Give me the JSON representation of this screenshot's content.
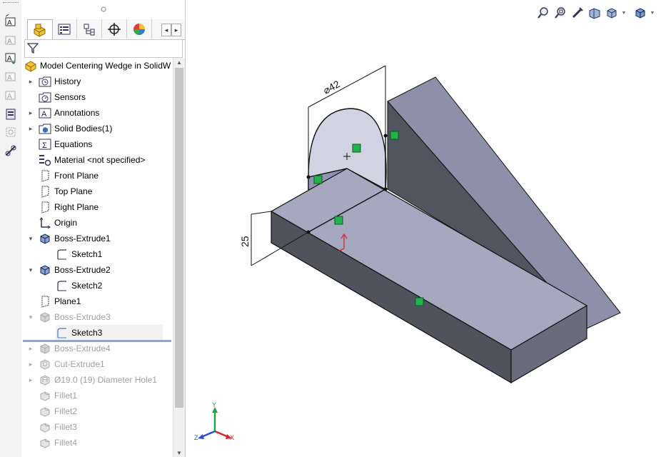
{
  "feature_tree": {
    "root": "Model Centering Wedge in SolidW",
    "items": [
      {
        "label": "History",
        "expander": "▸",
        "icon": "history-icon",
        "state": "normal"
      },
      {
        "label": "Sensors",
        "expander": "",
        "icon": "sensors-icon",
        "state": "normal"
      },
      {
        "label": "Annotations",
        "expander": "▸",
        "icon": "annotations-icon",
        "state": "normal"
      },
      {
        "label": "Solid Bodies(1)",
        "expander": "▸",
        "icon": "solid-bodies-icon",
        "state": "normal"
      },
      {
        "label": "Equations",
        "expander": "",
        "icon": "equations-icon",
        "state": "normal"
      },
      {
        "label": "Material <not specified>",
        "expander": "",
        "icon": "material-icon",
        "state": "normal"
      },
      {
        "label": "Front Plane",
        "expander": "",
        "icon": "plane-icon",
        "state": "normal"
      },
      {
        "label": "Top Plane",
        "expander": "",
        "icon": "plane-icon",
        "state": "normal"
      },
      {
        "label": "Right Plane",
        "expander": "",
        "icon": "plane-icon",
        "state": "normal"
      },
      {
        "label": "Origin",
        "expander": "",
        "icon": "origin-icon",
        "state": "normal"
      },
      {
        "label": "Boss-Extrude1",
        "expander": "▾",
        "icon": "extrude-icon",
        "state": "normal"
      },
      {
        "label": "Sketch1",
        "expander": "",
        "icon": "sketch-icon",
        "state": "child"
      },
      {
        "label": "Boss-Extrude2",
        "expander": "▾",
        "icon": "extrude-icon",
        "state": "normal"
      },
      {
        "label": "Sketch2",
        "expander": "",
        "icon": "sketch-icon",
        "state": "child"
      },
      {
        "label": "Plane1",
        "expander": "",
        "icon": "plane-icon",
        "state": "normal"
      },
      {
        "label": "Boss-Extrude3",
        "expander": "▾",
        "icon": "extrude-icon",
        "state": "dim"
      },
      {
        "label": "Sketch3",
        "expander": "",
        "icon": "sketch-icon",
        "state": "child-rolled"
      },
      {
        "label": "Boss-Extrude4",
        "expander": "▸",
        "icon": "extrude-icon",
        "state": "dim"
      },
      {
        "label": "Cut-Extrude1",
        "expander": "▸",
        "icon": "cut-extrude-icon",
        "state": "dim"
      },
      {
        "label": "Ø19.0 (19) Diameter Hole1",
        "expander": "▸",
        "icon": "hole-icon",
        "state": "dim"
      },
      {
        "label": "Fillet1",
        "expander": "",
        "icon": "fillet-icon",
        "state": "dim"
      },
      {
        "label": "Fillet2",
        "expander": "",
        "icon": "fillet-icon",
        "state": "dim"
      },
      {
        "label": "Fillet3",
        "expander": "",
        "icon": "fillet-icon",
        "state": "dim"
      },
      {
        "label": "Fillet4",
        "expander": "",
        "icon": "fillet-icon",
        "state": "dim"
      }
    ]
  },
  "tabs": [
    "feature-manager-tab",
    "property-manager-tab",
    "configuration-manager-tab",
    "dimxpert-manager-tab",
    "display-manager-tab"
  ],
  "tab_nav": {
    "prev": "◂",
    "next": "▸"
  },
  "viewport": {
    "dimension_diameter": "⌀42",
    "dimension_height": "25",
    "triad_labels": {
      "x": "X",
      "y": "Y",
      "z": "Z"
    }
  },
  "heads_up_toolbar": [
    "zoom-to-fit-icon",
    "zoom-to-area-icon",
    "previous-view-icon",
    "section-view-icon",
    "view-orientation-icon",
    "display-style-icon"
  ],
  "colors": {
    "body_top": "#a5a8bf",
    "body_side": "#50525e",
    "body_front": "#6a6c7d",
    "wedge_face": "#8d90a8",
    "relation_green": "#22b14c"
  }
}
